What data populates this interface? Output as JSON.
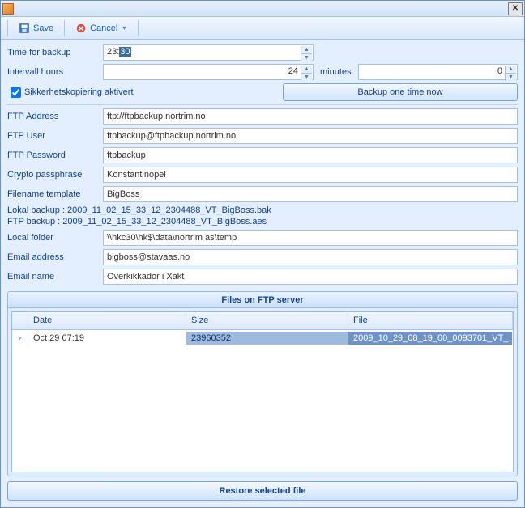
{
  "toolbar": {
    "save_label": "Save",
    "cancel_label": "Cancel"
  },
  "form": {
    "time_for_backup_label": "Time for backup",
    "time_for_backup_value_pre": "23:",
    "time_for_backup_value_sel": "30",
    "intervall_hours_label": "Intervall  hours",
    "intervall_hours_value": "24",
    "minutes_label": "minutes",
    "minutes_value": "0",
    "checkbox_label": "Sikkerhetskopiering aktivert",
    "backup_now_label": "Backup one time now",
    "ftp_address_label": "FTP Address",
    "ftp_address_value": "ftp://ftpbackup.nortrim.no",
    "ftp_user_label": "FTP User",
    "ftp_user_value": "ftpbackup@ftpbackup.nortrim.no",
    "ftp_password_label": "FTP Password",
    "ftp_password_value": "ftpbackup",
    "crypto_label": "Crypto passphrase",
    "crypto_value": "Konstantinopel",
    "filename_template_label": "Filename template",
    "filename_template_value": "BigBoss",
    "lokal_backup_line": "Lokal backup : 2009_11_02_15_33_12_2304488_VT_BigBoss.bak",
    "ftp_backup_line": "FTP backup : 2009_11_02_15_33_12_2304488_VT_BigBoss.aes",
    "local_folder_label": "Local folder",
    "local_folder_value": "\\\\hkc30\\hk$\\data\\nortrim as\\temp",
    "email_address_label": "Email address",
    "email_address_value": "bigboss@stavaas.no",
    "email_name_label": "Email name",
    "email_name_value": "Overkikkador i Xakt"
  },
  "panel": {
    "title": "Files on FTP server",
    "col_date": "Date",
    "col_size": "Size",
    "col_file": "File",
    "rows": [
      {
        "date": "Oct 29 07:19",
        "size": "23960352",
        "file": "2009_10_29_08_19_00_0093701_VT_…"
      }
    ]
  },
  "restore_label": "Restore selected file"
}
